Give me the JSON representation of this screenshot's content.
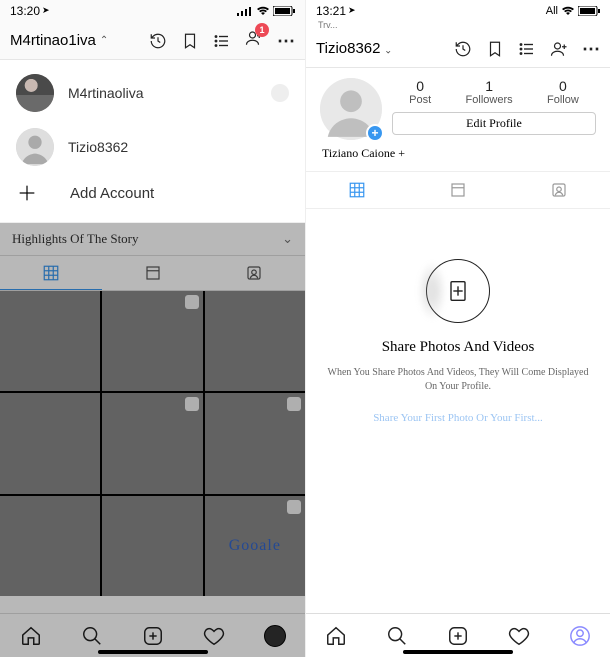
{
  "left": {
    "status": {
      "time": "13:20",
      "signal": "•ıll"
    },
    "header": {
      "username": "M4rtinao1iva",
      "notif_count": "1"
    },
    "accounts": {
      "primary": "M4rtinaoliva",
      "secondary": "Tizio8362",
      "add": "Add Account"
    },
    "highlights_label": "Highlights Of The Story"
  },
  "right": {
    "status": {
      "time": "13:21",
      "network": "All",
      "trv": "Trv..."
    },
    "header": {
      "username": "Tizio8362"
    },
    "stats": {
      "post_num": "0",
      "post_label": "Post",
      "followers_num": "1",
      "followers_label": "Followers",
      "follow_num": "0",
      "follow_label": "Follow"
    },
    "edit_profile": "Edit Profile",
    "display_name": "Tiziano Caione +",
    "empty": {
      "title": "Share Photos And Videos",
      "subtitle": "When You Share Photos And Videos, They Will Come Displayed On Your Profile.",
      "link": "Share Your First Photo Or Your First..."
    }
  }
}
